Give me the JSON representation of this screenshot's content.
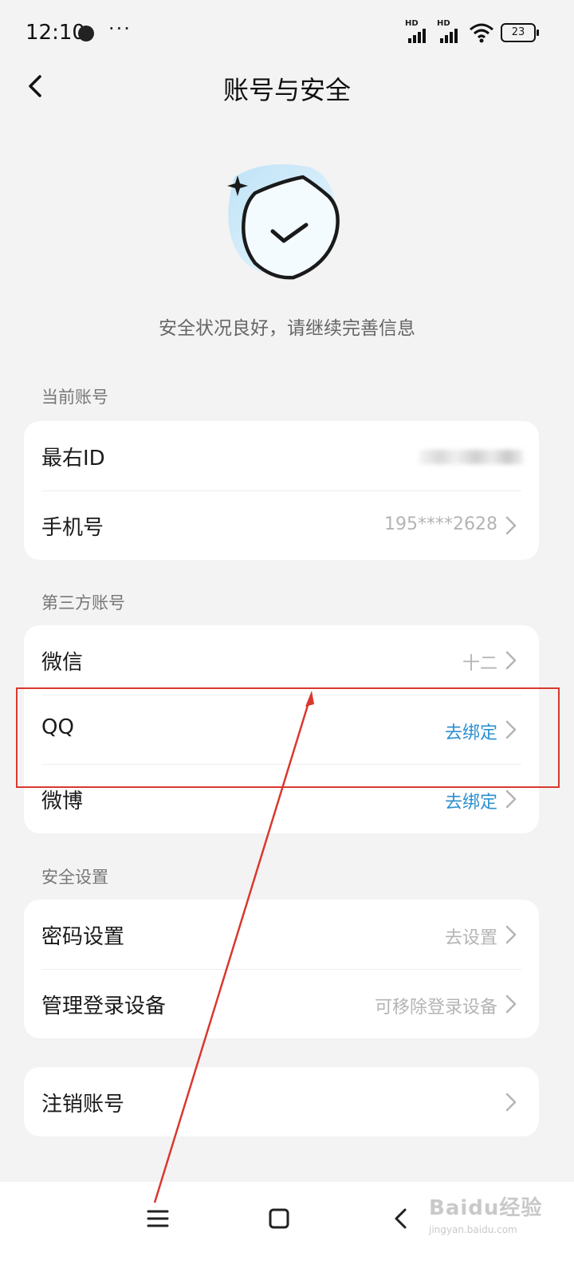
{
  "status_bar": {
    "time": "12:10",
    "more": "···",
    "signal1_label": "HD",
    "signal2_label": "HD",
    "battery": "23"
  },
  "header": {
    "title": "账号与安全",
    "back_icon": "chevron-left-icon"
  },
  "hero": {
    "icon": "shield-check-icon",
    "text": "安全状况良好，请继续完善信息"
  },
  "sections": {
    "current_account": {
      "title": "当前账号",
      "rows": [
        {
          "label": "最右ID",
          "value": ""
        },
        {
          "label": "手机号",
          "value": "195****2628"
        }
      ]
    },
    "third_party": {
      "title": "第三方账号",
      "rows": [
        {
          "label": "微信",
          "value": "十二"
        },
        {
          "label": "QQ",
          "value": "去绑定"
        },
        {
          "label": "微博",
          "value": "去绑定"
        }
      ]
    },
    "security": {
      "title": "安全设置",
      "rows": [
        {
          "label": "密码设置",
          "value": "去设置"
        },
        {
          "label": "管理登录设备",
          "value": "可移除登录设备"
        }
      ]
    },
    "deactivate": {
      "rows": [
        {
          "label": "注销账号",
          "value": ""
        }
      ]
    }
  },
  "colors": {
    "background": "#f3f3f3",
    "card": "#ffffff",
    "link_blue": "#2b8fd0",
    "muted_value": "#b4b4b4",
    "annotation_red": "#d9382e"
  },
  "watermark": {
    "main": "Baidu经验",
    "sub": "jingyan.baidu.com"
  }
}
